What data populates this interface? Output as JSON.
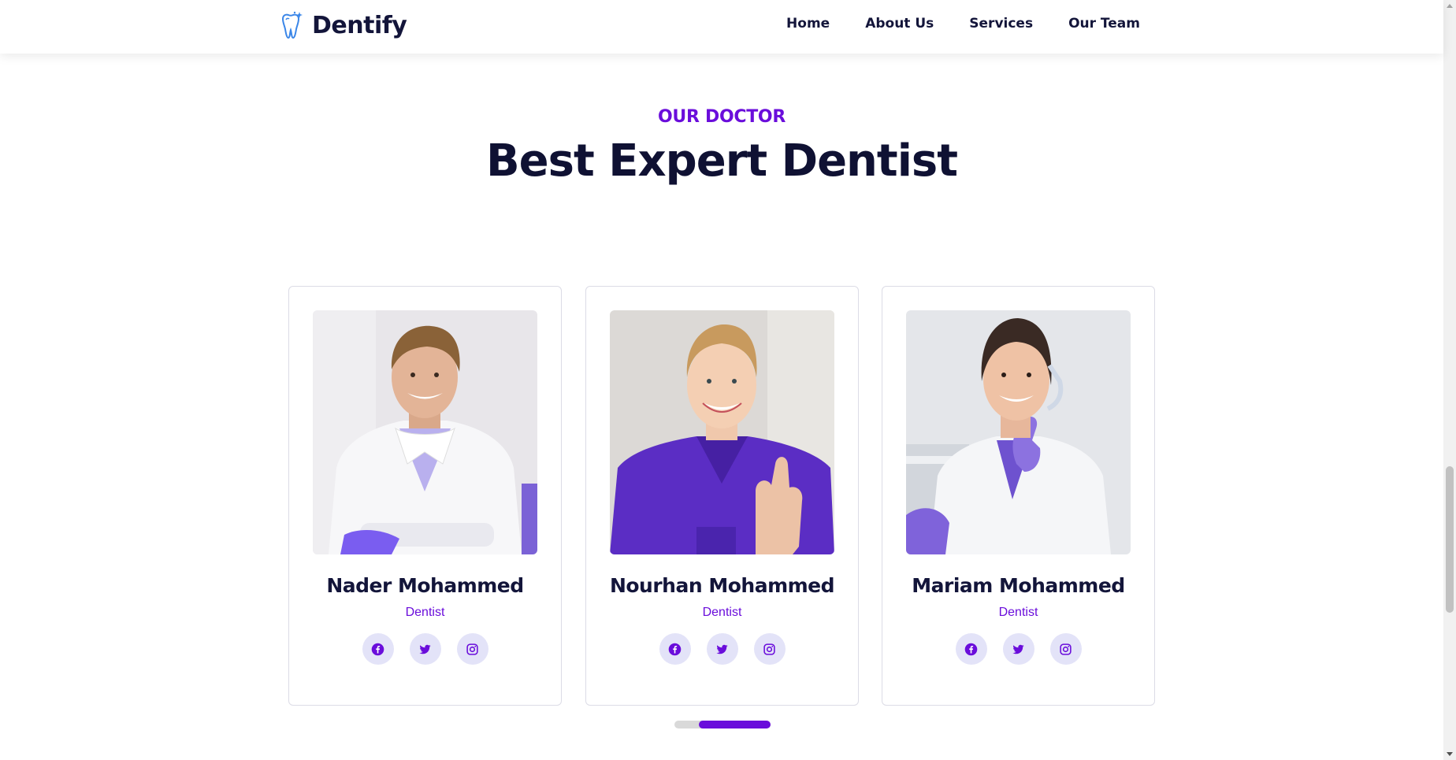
{
  "brand": {
    "name": "Dentify",
    "logo_icon": "tooth-icon",
    "accent": "#3a86e8"
  },
  "nav": {
    "items": [
      {
        "label": "Home"
      },
      {
        "label": "About Us"
      },
      {
        "label": "Services"
      },
      {
        "label": "Our Team"
      }
    ]
  },
  "section": {
    "subtitle": "OUR DOCTOR",
    "title": "Best Expert Dentist"
  },
  "colors": {
    "primary": "#6a0ddb",
    "heading": "#0f1133",
    "social_bg": "#e3e3f8"
  },
  "doctors": [
    {
      "name": "Nader Mohammed",
      "role": "Dentist",
      "photo": "male dentist in white coat with arms crossed"
    },
    {
      "name": "Nourhan Mohammed",
      "role": "Dentist",
      "photo": "female dentist in purple scrubs giving thumbs up"
    },
    {
      "name": "Mariam Mohammed",
      "role": "Dentist",
      "photo": "female dentist in white coat holding face mask"
    }
  ],
  "socials": [
    "facebook-icon",
    "twitter-icon",
    "instagram-icon"
  ],
  "carousel": {
    "active_page": 2,
    "pages": 2
  }
}
